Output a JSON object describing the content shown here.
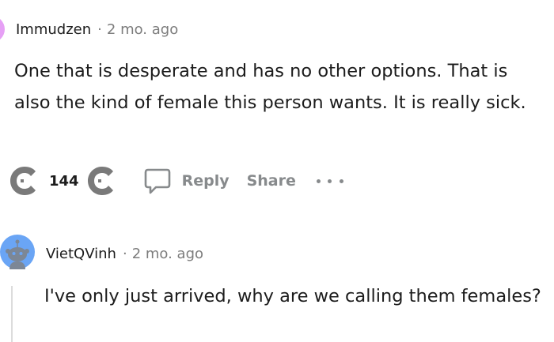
{
  "comments": [
    {
      "username": "Immudzen",
      "separator": "·",
      "time": "2 mo. ago",
      "body": "One that is desperate and has no other options. That is also the kind of female this person wants. It is really sick.",
      "score": "144",
      "actions": {
        "reply": "Reply",
        "share": "Share"
      }
    },
    {
      "username": "VietQVinh",
      "separator": "·",
      "time": "2 mo. ago",
      "body": "I've only just arrived, why are we calling them females?"
    }
  ],
  "icons": {
    "upvote": "upvote-icon",
    "downvote": "downvote-icon",
    "reply": "speech-bubble-icon",
    "more": "ellipsis-icon",
    "avatar": "snoo-avatar-icon"
  },
  "colors": {
    "text": "#1c1c1c",
    "muted": "#7c7c7c",
    "action": "#878a8c",
    "vote_icon": "#7a7a7a",
    "avatar1": "#e6a0f5",
    "avatar2_bg": "#6aa5f5"
  }
}
